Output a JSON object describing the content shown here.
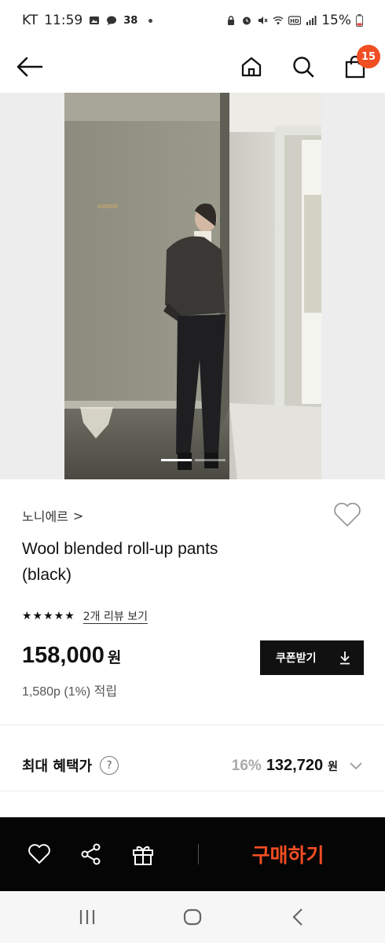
{
  "status_bar": {
    "carrier": "KT",
    "time": "11:59",
    "notification_count": "38",
    "battery": "15%"
  },
  "nav": {
    "cart_count": "15"
  },
  "product": {
    "brand": "노니에르",
    "brand_chevron": ">",
    "title_line1": "Wool blended roll-up pants",
    "title_line2": "(black)",
    "stars": "★★★★★",
    "rating": 5,
    "review_link": "2개 리뷰 보기",
    "price": "158,000",
    "price_unit": "원",
    "coupon_label": "쿠폰받기",
    "points": "1,580p (1%) 적립"
  },
  "benefit": {
    "label": "최대 혜택가",
    "help": "?",
    "discount": "16%",
    "final_price": "132,720",
    "final_unit": "원"
  },
  "bottom_bar": {
    "buy_label": "구매하기"
  },
  "gallery": {
    "page_count": 2,
    "active_index": 1
  },
  "colors": {
    "accent": "#f04e23",
    "bar_bg": "#050505"
  }
}
